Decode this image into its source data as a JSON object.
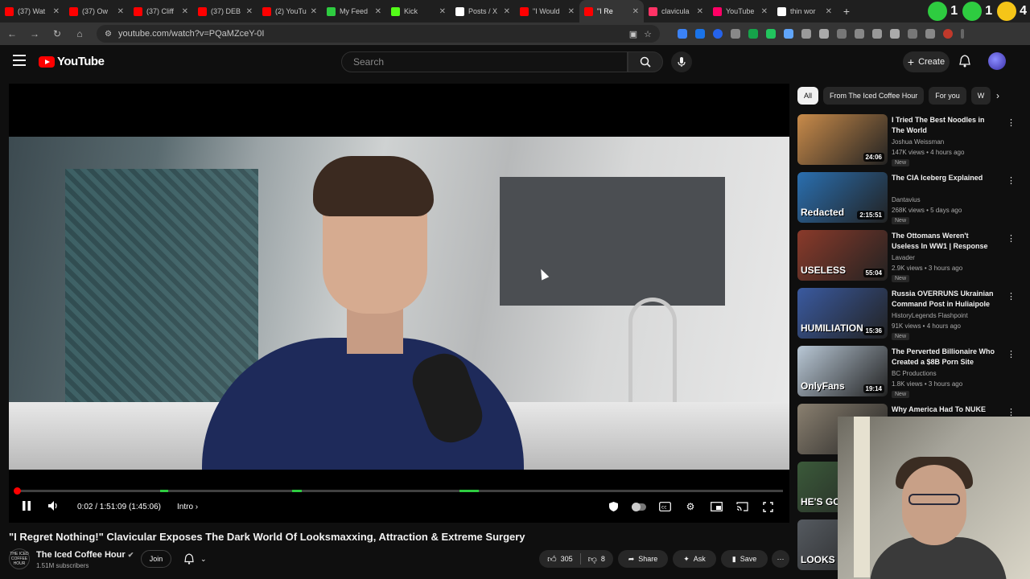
{
  "browser": {
    "tabs": [
      {
        "label": "(37) Wat",
        "color": "#ff0000"
      },
      {
        "label": "(37) Ow",
        "color": "#ff0000"
      },
      {
        "label": "(37) Cliff",
        "color": "#ff0000"
      },
      {
        "label": "(37) DEB",
        "color": "#ff0000"
      },
      {
        "label": "(2) YouTu",
        "color": "#ff0000"
      },
      {
        "label": "My Feed",
        "color": "#2ecc40"
      },
      {
        "label": "Kick",
        "color": "#53fc18"
      },
      {
        "label": "Posts / X",
        "color": "#ffffff"
      },
      {
        "label": "\"I Would",
        "color": "#ff0000"
      },
      {
        "label": "\"I Re",
        "color": "#ff0000",
        "active": true
      },
      {
        "label": "clavicula",
        "color": "#ff3366"
      },
      {
        "label": "YouTube",
        "color": "#ff0066"
      },
      {
        "label": "thin wor",
        "color": "#ffffff"
      }
    ],
    "url": "youtube.com/watch?v=PQaMZceY-0I",
    "ext_badge_1": "1",
    "ext_badge_2": "1",
    "ext_badge_3": "4"
  },
  "header": {
    "logo_text": "YouTube",
    "search_placeholder": "Search",
    "create_label": "Create"
  },
  "player": {
    "time": "0:02 / 1:51:09 (1:45:06)",
    "chapter": "Intro",
    "progress_fraction": 0.0003
  },
  "video": {
    "title": "\"I Regret Nothing!\" Clavicular Exposes The Dark World Of Looksmaxxing, Attraction & Extreme Surgery",
    "channel": "The Iced Coffee Hour",
    "channel_avatar_text": "THE ICED COFFEE HOUR",
    "subscribers": "1.51M subscribers",
    "join_label": "Join",
    "likes": "305",
    "dislikes": "8",
    "share_label": "Share",
    "ask_label": "Ask",
    "save_label": "Save"
  },
  "sidebar": {
    "chips": [
      "All",
      "From The Iced Coffee Hour",
      "For you",
      "W"
    ],
    "recommendations": [
      {
        "title": "I Tried The Best Noodles in The World",
        "channel": "Joshua Weissman",
        "meta": "147K views • 4 hours ago",
        "badge": "New",
        "duration": "24:06",
        "thumb_text": "",
        "thumb_color": "#c98b4a"
      },
      {
        "title": "The CIA Iceberg Explained",
        "channel": "Dantavius",
        "meta": "268K views • 5 days ago",
        "badge": "New",
        "duration": "2:15:51",
        "thumb_text": "Redacted",
        "thumb_color": "#2a6fb0"
      },
      {
        "title": "The Ottomans Weren't Useless In WW1 | Response to Henry ...",
        "channel": "Lavader",
        "meta": "2.9K views • 3 hours ago",
        "badge": "New",
        "duration": "55:04",
        "thumb_text": "USELESS",
        "thumb_color": "#8a3a2a"
      },
      {
        "title": "Russia OVERRUNS Ukrainian Command Post in Huliaipole",
        "channel": "HistoryLegends Flashpoint",
        "meta": "91K views • 4 hours ago",
        "badge": "New",
        "duration": "15:36",
        "thumb_text": "HUMILIATION",
        "thumb_color": "#3a5aa0"
      },
      {
        "title": "The Perverted Billionaire Who Created a $8B Porn Site",
        "channel": "BC Productions",
        "meta": "1.8K views • 3 hours ago",
        "badge": "New",
        "duration": "19:14",
        "thumb_text": "OnlyFans",
        "thumb_color": "#b9c8d6"
      },
      {
        "title": "Why America Had To NUKE Japan Twice (Explained)",
        "channel": "",
        "meta": "",
        "badge": "",
        "duration": "",
        "thumb_text": "",
        "thumb_color": "#8a8070"
      },
      {
        "title": "",
        "channel": "",
        "meta": "",
        "badge": "",
        "duration": "",
        "thumb_text": "HE'S GOIN",
        "thumb_color": "#3b5a3a"
      },
      {
        "title": "",
        "channel": "",
        "meta": "",
        "badge": "",
        "duration": "",
        "thumb_text": "LOOKS",
        "thumb_color": "#555a60"
      }
    ]
  },
  "colors": {
    "accent": "#ff0000",
    "background": "#0f0f0f",
    "chapter_marker": "#2ecc40"
  }
}
